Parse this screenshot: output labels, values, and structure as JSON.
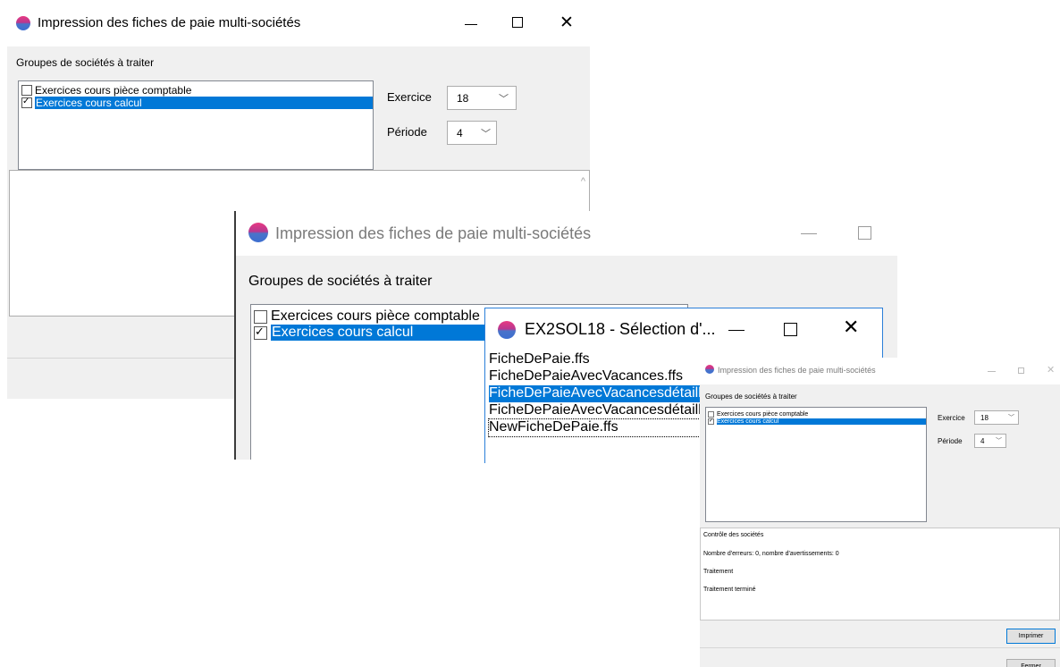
{
  "window1": {
    "title": "Impression des fiches de paie multi-sociétés",
    "group_label": "Groupes de sociétés à traiter",
    "groups": [
      {
        "label": "Exercices cours pièce comptable",
        "checked": false,
        "selected": false
      },
      {
        "label": "Exercices cours calcul",
        "checked": true,
        "selected": true
      }
    ],
    "exercice_label": "Exercice",
    "exercice_value": "18",
    "periode_label": "Période",
    "periode_value": "4",
    "scroll_up_glyph": "^"
  },
  "window2": {
    "title": "Impression des fiches de paie multi-sociétés",
    "group_label": "Groupes de sociétés à traiter",
    "groups": [
      {
        "label": "Exercices cours pièce comptable",
        "checked": false,
        "selected": false
      },
      {
        "label": "Exercices cours calcul",
        "checked": true,
        "selected": true
      }
    ]
  },
  "file_dialog": {
    "title": "EX2SOL18 - Sélection d'...",
    "files": [
      {
        "name": "FicheDePaie.ffs",
        "selected": false,
        "focused": false
      },
      {
        "name": "FicheDePaieAvecVacances.ffs",
        "selected": false,
        "focused": false
      },
      {
        "name": "FicheDePaieAvecVacancesdétaillé",
        "selected": true,
        "focused": false
      },
      {
        "name": "FicheDePaieAvecVacancesdétaillé",
        "selected": false,
        "focused": false
      },
      {
        "name": "NewFicheDePaie.ffs",
        "selected": false,
        "focused": true
      }
    ]
  },
  "window3": {
    "title": "Impression des fiches de paie multi-sociétés",
    "group_label": "Groupes de sociétés à traiter",
    "groups": [
      {
        "label": "Exercices cours pièce comptable",
        "checked": false,
        "selected": false
      },
      {
        "label": "Exercices cours calcul",
        "checked": true,
        "selected": true
      }
    ],
    "exercice_label": "Exercice",
    "exercice_value": "18",
    "periode_label": "Période",
    "periode_value": "4",
    "log_lines": [
      "Contrôle des sociétés",
      "Nombre d'erreurs: 0, nombre d'avertissements: 0",
      "Traitement",
      "Traitement terminé"
    ],
    "print_button": "Imprimer",
    "close_button": "Fermer"
  },
  "icons": {
    "minimize": "minimize-icon",
    "maximize": "maximize-icon",
    "close": "close-icon",
    "dropdown": "chevron-down-icon"
  },
  "colors": {
    "selection": "#0078d7",
    "window_bg": "#f0f0f0"
  }
}
